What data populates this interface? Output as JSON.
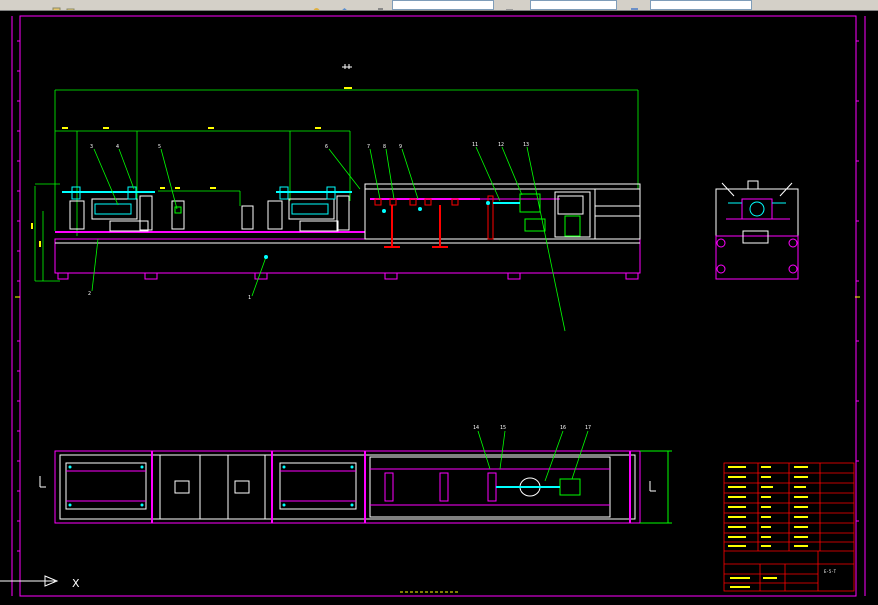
{
  "toolbar": {
    "title_field": "",
    "field2": "",
    "field3": ""
  },
  "drawing": {
    "crosshair_label": "X",
    "front_view_balloons": [
      "3",
      "4",
      "5",
      "6",
      "7",
      "8",
      "9",
      "11",
      "12",
      "13"
    ],
    "front_view_balloons_bottom": [
      "2",
      "1"
    ],
    "plan_view_balloons": [
      "14",
      "15",
      "16",
      "17"
    ],
    "title_block_name": "E-5-T"
  },
  "colors": {
    "background": "#000000",
    "magenta": "#ff00ff",
    "white": "#ffffff",
    "green": "#00ff00",
    "cyan": "#00ffff",
    "red": "#ff0000",
    "yellow": "#ffff00"
  }
}
